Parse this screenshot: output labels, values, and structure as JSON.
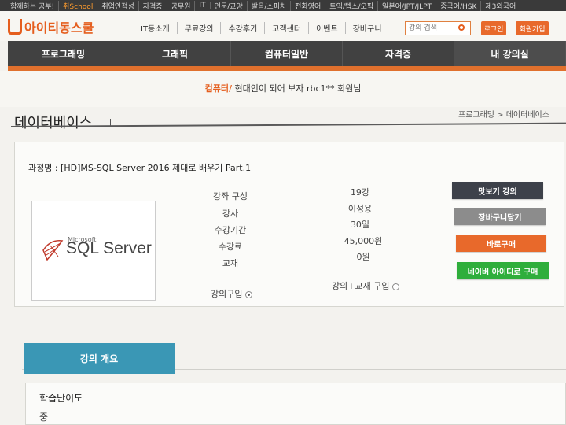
{
  "topbar": {
    "items": [
      "함께하는 공부!",
      "취업인적성",
      "자격증",
      "공무원",
      "IT",
      "인문/교양",
      "발음/스피치",
      "전화영어",
      "토익/텝스/오픽",
      "일본어/JPT/JLPT",
      "중국어/HSK",
      "제3외국어"
    ],
    "highlight": "취School"
  },
  "header": {
    "logo": "아이티동스쿨",
    "gnb": [
      "IT동소개",
      "무료강의",
      "수강후기",
      "고객센터",
      "이벤트",
      "장바구니"
    ],
    "search_placeholder": "강의 검색",
    "login_label": "로그인",
    "join_label": "회원가입"
  },
  "nav": [
    "프로그래밍",
    "그래픽",
    "컴퓨터일반",
    "자격증",
    "내 강의실"
  ],
  "welcome": {
    "highlight": "컴퓨터/",
    "text": "현대인이 되어 보자 rbc1** 회원님"
  },
  "page": {
    "title": "데이터베이스",
    "breadcrumb": "프로그래밍 > 데이터베이스"
  },
  "course": {
    "name": "과정명 : [HD]MS-SQL Server 2016 제대로 배우기 Part.1",
    "logo_small": "Microsoft",
    "logo_big": "SQL Server",
    "info": [
      {
        "label": "강좌 구성",
        "value": "19강"
      },
      {
        "label": "강사",
        "value": "이성용"
      },
      {
        "label": "수강기간",
        "value": "30일"
      },
      {
        "label": "수강료",
        "value": "45,000원"
      },
      {
        "label": "교재",
        "value": "0원"
      }
    ],
    "option_lecture": "강의구입",
    "option_lecture_book": "강의+교재 구입"
  },
  "buttons": {
    "preview": "맛보기 강의",
    "cart": "장바구니담기",
    "buy_now": "바로구매",
    "naver": "네이버 아이디로 구매"
  },
  "tab": {
    "overview": "강의 개요"
  },
  "details": {
    "difficulty_label": "학습난이도",
    "difficulty_value": "중"
  },
  "colors": {
    "accent": "#e8692b",
    "nav_bg": "#414141",
    "tab": "#3a97b5",
    "naver": "#2fae3c",
    "preview": "#3d414a",
    "cart": "#8c8c8c"
  }
}
